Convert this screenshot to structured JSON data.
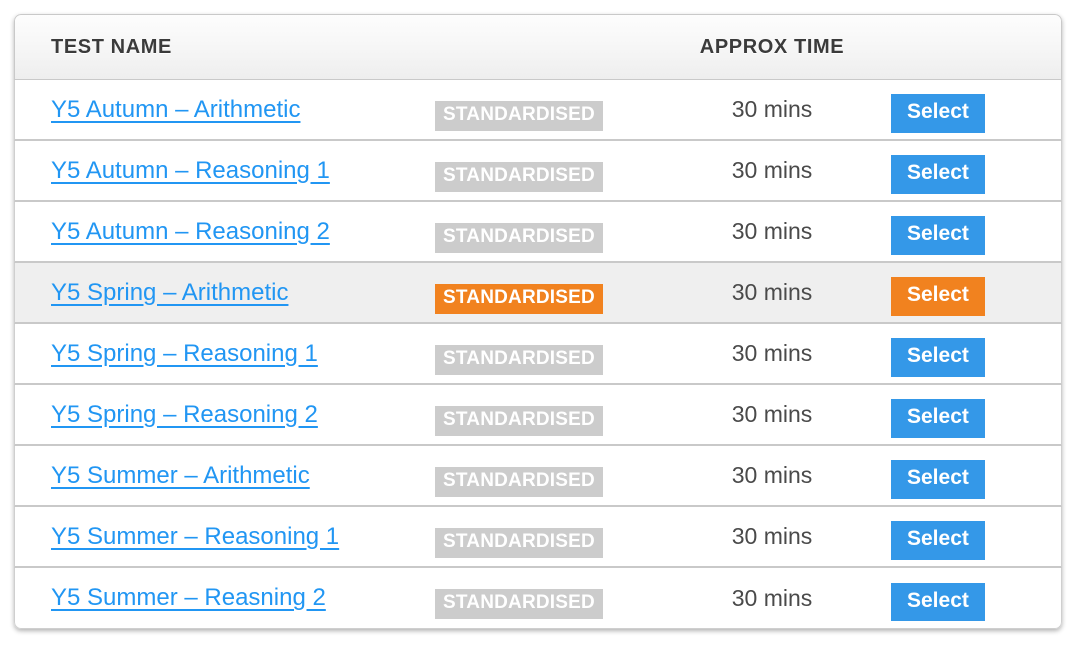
{
  "table": {
    "columns": {
      "name": "TEST NAME",
      "badge": "",
      "time": "APPROX TIME",
      "action": ""
    },
    "colors": {
      "link": "#2196f3",
      "badge_default": "#cccccc",
      "badge_active": "#f1821f",
      "button_default": "#3498e8",
      "button_active": "#f1821f",
      "row_selected_bg": "#efefef",
      "header_text": "#3b3b3b"
    },
    "rows": [
      {
        "name": "Y5 Autumn – Arithmetic",
        "badge": "STANDARDISED",
        "time": "30 mins",
        "action": "Select",
        "selected": false
      },
      {
        "name": "Y5 Autumn – Reasoning 1",
        "badge": "STANDARDISED",
        "time": "30 mins",
        "action": "Select",
        "selected": false
      },
      {
        "name": "Y5 Autumn – Reasoning 2",
        "badge": "STANDARDISED",
        "time": "30 mins",
        "action": "Select",
        "selected": false
      },
      {
        "name": "Y5 Spring – Arithmetic",
        "badge": "STANDARDISED",
        "time": "30 mins",
        "action": "Select",
        "selected": true
      },
      {
        "name": "Y5 Spring – Reasoning 1",
        "badge": "STANDARDISED",
        "time": "30 mins",
        "action": "Select",
        "selected": false
      },
      {
        "name": "Y5 Spring – Reasoning 2",
        "badge": "STANDARDISED",
        "time": "30 mins",
        "action": "Select",
        "selected": false
      },
      {
        "name": "Y5 Summer – Arithmetic",
        "badge": "STANDARDISED",
        "time": "30 mins",
        "action": "Select",
        "selected": false
      },
      {
        "name": "Y5 Summer – Reasoning 1",
        "badge": "STANDARDISED",
        "time": "30 mins",
        "action": "Select",
        "selected": false
      },
      {
        "name": "Y5 Summer – Reasning 2",
        "badge": "STANDARDISED",
        "time": "30 mins",
        "action": "Select",
        "selected": false
      }
    ]
  }
}
